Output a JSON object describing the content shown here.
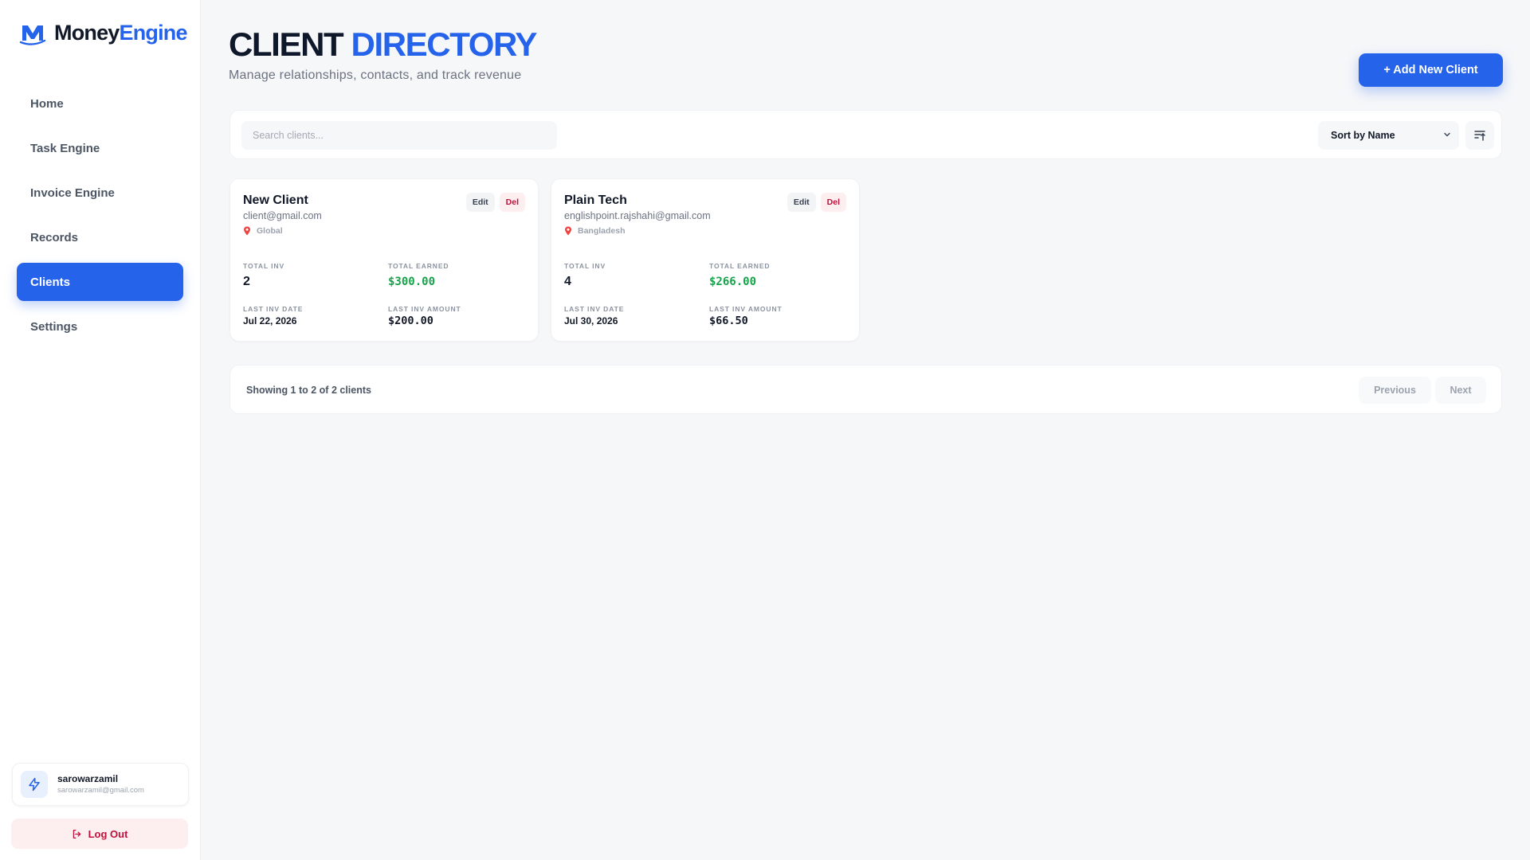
{
  "brand": {
    "name_main": "Money",
    "name_accent": "Engine",
    "logo_icon": "m-logo-icon",
    "accent_color": "#2563eb"
  },
  "sidebar": {
    "items": [
      {
        "label": "Home",
        "active": false
      },
      {
        "label": "Task Engine",
        "active": false
      },
      {
        "label": "Invoice Engine",
        "active": false
      },
      {
        "label": "Records",
        "active": false
      },
      {
        "label": "Clients",
        "active": true
      },
      {
        "label": "Settings",
        "active": false
      }
    ],
    "user": {
      "name": "sarowarzamil",
      "email": "sarowarzamil@gmail.com",
      "avatar_icon": "bolt-icon"
    },
    "logout_label": "Log Out"
  },
  "header": {
    "title_main": "CLIENT",
    "title_accent": "DIRECTORY",
    "subtitle": "Manage relationships, contacts, and track revenue",
    "add_button_label": "+ Add New Client"
  },
  "toolbar": {
    "search_placeholder": "Search clients...",
    "search_value": "",
    "sort_label": "Sort by Name",
    "sort_direction_icon": "sort-ascending-icon"
  },
  "labels": {
    "total_inv": "TOTAL INV",
    "total_earned": "TOTAL EARNED",
    "last_inv_date": "LAST INV DATE",
    "last_inv_amount": "LAST INV AMOUNT",
    "edit": "Edit",
    "del": "Del"
  },
  "clients": [
    {
      "name": "New Client",
      "email": "client@gmail.com",
      "location": "Global",
      "total_inv": "2",
      "total_earned": "$300.00",
      "last_inv_date": "Jul 22, 2026",
      "last_inv_amount": "$200.00"
    },
    {
      "name": "Plain Tech",
      "email": "englishpoint.rajshahi@gmail.com",
      "location": "Bangladesh",
      "total_inv": "4",
      "total_earned": "$266.00",
      "last_inv_date": "Jul 30, 2026",
      "last_inv_amount": "$66.50"
    }
  ],
  "pagination": {
    "info": "Showing 1 to 2 of 2 clients",
    "previous_label": "Previous",
    "next_label": "Next"
  },
  "colors": {
    "primary": "#2563eb",
    "money": "#16a34a",
    "danger": "#be123c",
    "pin": "#ef4444"
  }
}
